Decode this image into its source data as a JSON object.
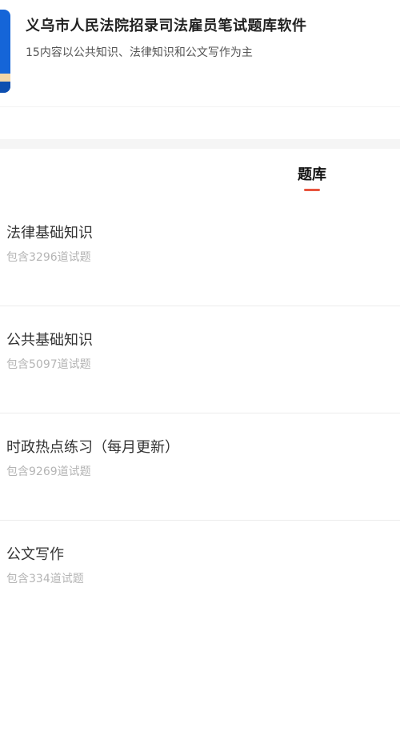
{
  "header": {
    "title": "义乌市人民法院招录司法雇员笔试题库软件",
    "subtitle": "15内容以公共知识、法律知识和公文写作为主",
    "thumbnail_color": "#1565d8"
  },
  "tabs": [
    {
      "label": "题库",
      "active": true
    }
  ],
  "accent_color": "#e8553e",
  "items": [
    {
      "title": "法律基础知识",
      "count": "包含3296道试题"
    },
    {
      "title": "公共基础知识",
      "count": "包含5097道试题"
    },
    {
      "title": "时政热点练习（每月更新）",
      "count": "包含9269道试题"
    },
    {
      "title": "公文写作",
      "count": "包含334道试题"
    }
  ]
}
